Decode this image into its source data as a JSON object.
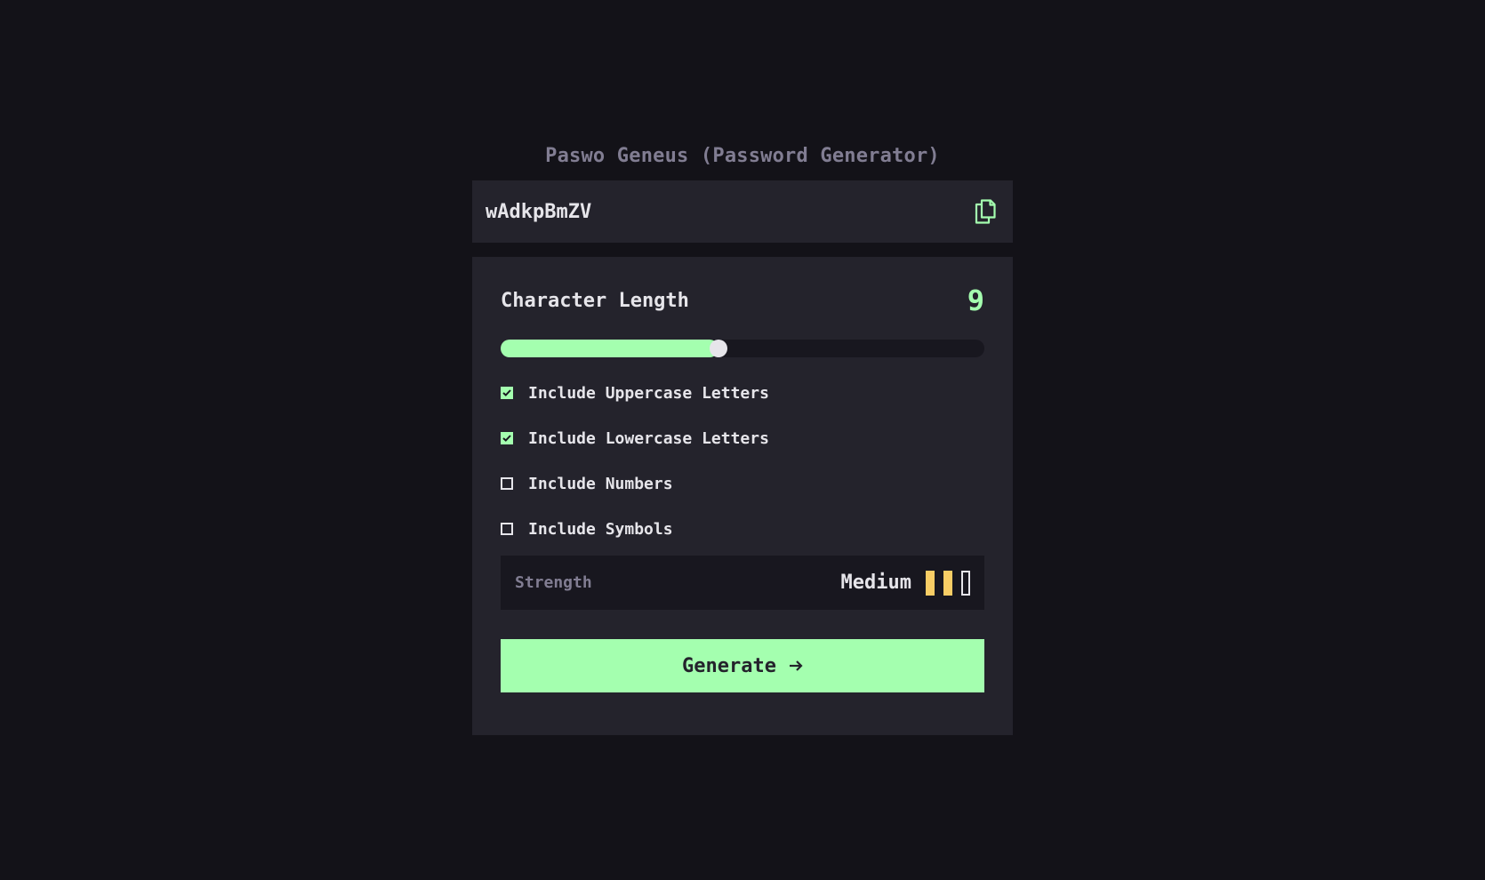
{
  "app": {
    "title": "Paswo Geneus (Password Generator)"
  },
  "output": {
    "password": "wAdkpBmZV",
    "copy_icon": "copy-icon"
  },
  "length": {
    "label": "Character Length",
    "value": "9",
    "slider_fraction": 0.45
  },
  "options": [
    {
      "label": "Include Uppercase Letters",
      "checked": true
    },
    {
      "label": "Include Lowercase Letters",
      "checked": true
    },
    {
      "label": "Include Numbers",
      "checked": false
    },
    {
      "label": "Include Symbols",
      "checked": false
    }
  ],
  "strength": {
    "label": "Strength",
    "level": "Medium",
    "bars_filled": 2,
    "bars_total": 3
  },
  "generate": {
    "label": "Generate",
    "icon": "arrow-right-icon"
  },
  "colors": {
    "background": "#131218",
    "panel": "#24232C",
    "accent": "#A4FFAF",
    "strength_medium": "#F8CD65",
    "muted": "#817D92",
    "text": "#E6E5EA"
  }
}
